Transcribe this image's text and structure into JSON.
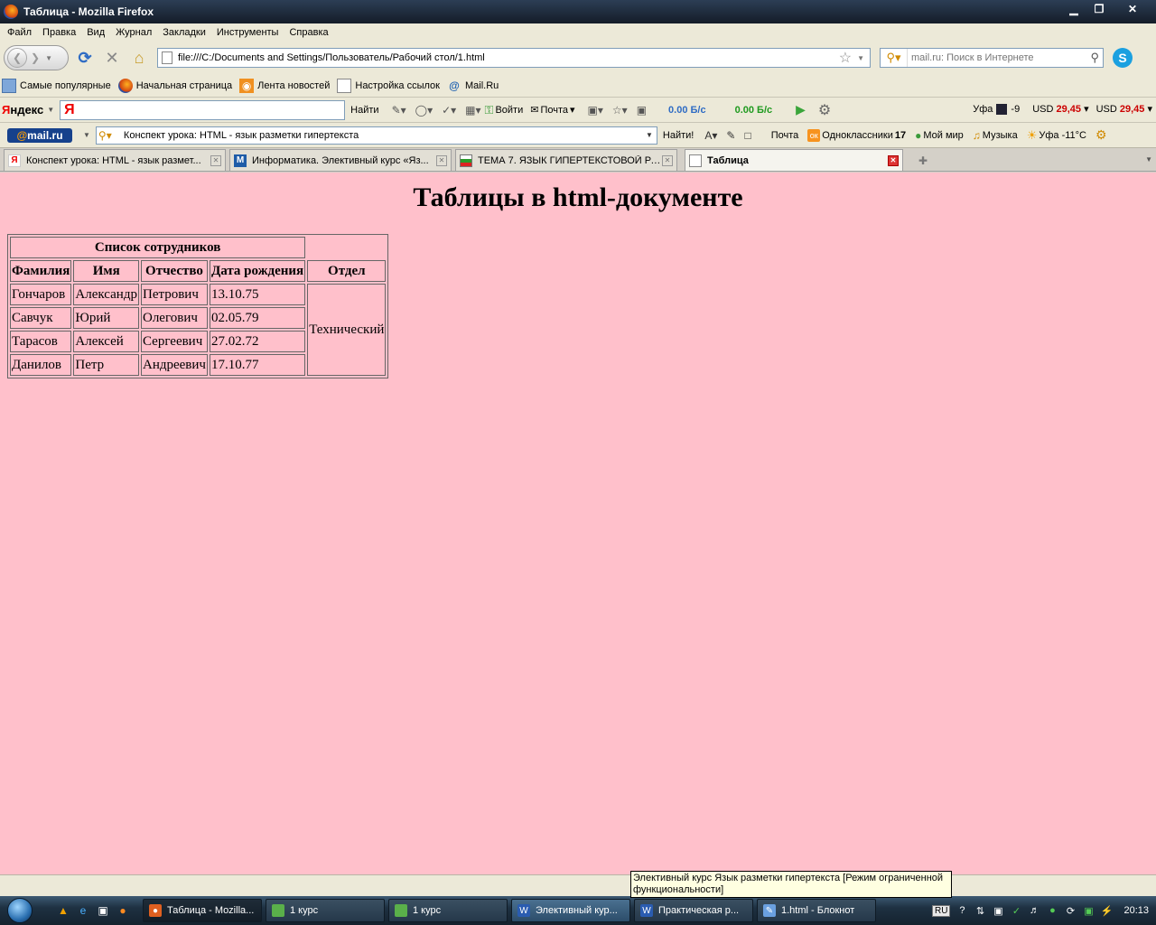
{
  "window": {
    "title": "Таблица - Mozilla Firefox",
    "minimize_glyph": "▁",
    "maximize_glyph": "❐",
    "close_glyph": "✕"
  },
  "menu": [
    "Файл",
    "Правка",
    "Вид",
    "Журнал",
    "Закладки",
    "Инструменты",
    "Справка"
  ],
  "navigation": {
    "url": "file:///C:/Documents and Settings/Пользователь/Рабочий стол/1.html",
    "search_placeholder": "mail.ru: Поиск в Интернете"
  },
  "bookmarks": [
    {
      "label": "Самые популярные",
      "icon": "folder-icon"
    },
    {
      "label": "Начальная страница",
      "icon": "firefox-icon"
    },
    {
      "label": "Лента новостей",
      "icon": "rss-icon"
    },
    {
      "label": "Настройка ссылок",
      "icon": "page-icon"
    },
    {
      "label": "Mail.Ru",
      "icon": "at-icon"
    }
  ],
  "yandex_bar": {
    "logo_first": "Я",
    "logo_rest": "ндекс",
    "input_logo": "Я",
    "find_label": "Найти",
    "login_label": "Войти",
    "mail_label": "Почта",
    "speed_down": "0.00 Б/с",
    "speed_up": "0.00 Б/с",
    "city": "Уфа",
    "temp": "-9",
    "usd1_label": "USD",
    "usd1_value": "29,45",
    "usd2_label": "USD",
    "usd2_value": "29,45"
  },
  "mailru_bar": {
    "logo_at": "@",
    "logo_text": "mail.ru",
    "search_text": "Конспект урока: HTML - язык разметки гипертекста",
    "find_label": "Найти!",
    "mail_label": "Почта",
    "ok_icon_text": "ок",
    "ok_label": "Одноклассники",
    "ok_count": "17",
    "myworld_label": "Мой мир",
    "music_label": "Музыка",
    "weather_label": "Уфа -11°C"
  },
  "tabs": [
    {
      "label": "Конспект урока: HTML - язык размет...",
      "icon_text": "Я",
      "active": false
    },
    {
      "label": "Информатика. Элективный курс «Яз...",
      "icon_text": "M",
      "active": false
    },
    {
      "label": "ТЕМА 7. ЯЗЫК ГИПЕРТЕКСТОВОЙ РАЗ...",
      "icon_text": "",
      "active": false
    },
    {
      "label": "Таблица",
      "icon_text": "",
      "active": true
    }
  ],
  "page": {
    "heading": "Таблицы в html-документе",
    "table": {
      "caption": "Список сотрудников",
      "headers": [
        "Фамилия",
        "Имя",
        "Отчество",
        "Дата рождения",
        "Отдел"
      ],
      "rows": [
        [
          "Гончаров",
          "Александр",
          "Петрович",
          "13.10.75"
        ],
        [
          "Савчук",
          "Юрий",
          "Олегович",
          "02.05.79"
        ],
        [
          "Тарасов",
          "Алексей",
          "Сергеевич",
          "27.02.72"
        ],
        [
          "Данилов",
          "Петр",
          "Андреевич",
          "17.10.77"
        ]
      ],
      "department": "Технический"
    }
  },
  "tooltip": "Элективный курс Язык разметки гипертекста [Режим ограниченной функциональности]",
  "taskbar": {
    "tasks": [
      {
        "label": "Таблица - Mozilla...",
        "icon": "firefox-icon"
      },
      {
        "label": "1 курс",
        "icon": "folder-icon"
      },
      {
        "label": "1 курс",
        "icon": "folder-icon"
      },
      {
        "label": "Элективный кур...",
        "icon": "word-icon"
      },
      {
        "label": "Практическая р...",
        "icon": "word-icon"
      },
      {
        "label": "1.html - Блокнот",
        "icon": "notepad-icon"
      }
    ],
    "lang": "RU",
    "clock": "20:13"
  },
  "colors": {
    "page_background": "#ffc0cb",
    "speed_down": "#2f6cc4",
    "speed_up": "#1f9a1f",
    "usd_value": "#cc0000"
  }
}
